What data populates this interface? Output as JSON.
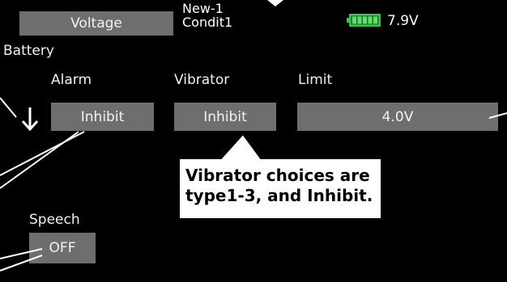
{
  "header": {
    "screen_title": "Voltage",
    "model_name": "New-1",
    "condition_name": "Condit1",
    "battery_voltage": "7.9V",
    "battery_color": "#3ec24a"
  },
  "section": {
    "title": "Battery"
  },
  "fields": {
    "alarm": {
      "label": "Alarm",
      "value": "Inhibit"
    },
    "vibrator": {
      "label": "Vibrator",
      "value": "Inhibit"
    },
    "limit": {
      "label": "Limit",
      "value": "4.0V"
    },
    "speech": {
      "label": "Speech",
      "value": "OFF"
    }
  },
  "annotation": {
    "line1": "Vibrator choices are",
    "line2": "type1-3, and Inhibit."
  },
  "icons": {
    "down_arrow": "arrow-down-icon",
    "battery": "battery-icon"
  }
}
